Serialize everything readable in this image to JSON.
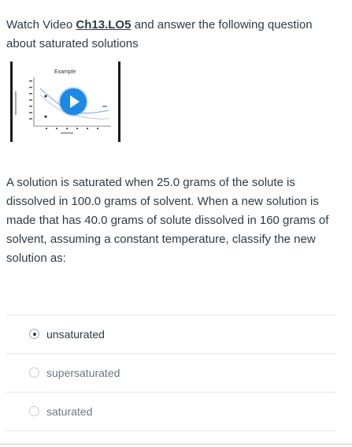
{
  "intro": {
    "text_before": "Watch Video ",
    "link": "Ch13.LO5",
    "text_after": " and answer the following question about saturated solutions"
  },
  "video": {
    "title": "Example",
    "play_icon": "play-icon"
  },
  "question": {
    "text": "A solution is saturated when 25.0 grams of the solute is dissolved in 100.0 grams of solvent.  When a new solution is made that has 40.0 grams of solute dissolved in 160 grams of solvent, assuming a constant temperature, classify the new solution as:"
  },
  "answers": [
    {
      "label": "unsaturated",
      "selected": true
    },
    {
      "label": "supersaturated",
      "selected": false
    },
    {
      "label": "saturated",
      "selected": false
    }
  ],
  "colors": {
    "text": "#2d3b45",
    "play_button": "#1e88e5",
    "divider": "#e3e6e8"
  }
}
